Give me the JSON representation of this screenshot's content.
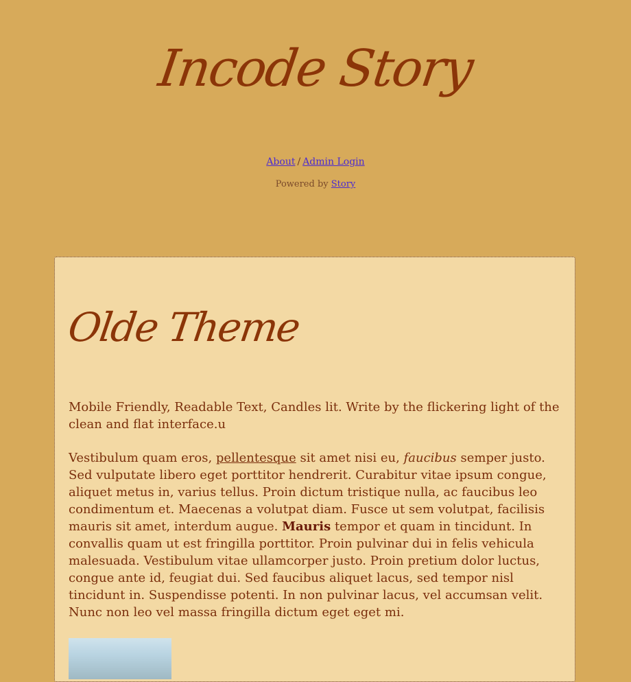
{
  "site": {
    "title": "Incode Story"
  },
  "nav": {
    "about_label": "About",
    "separator": "/",
    "admin_label": "Admin Login"
  },
  "footer": {
    "powered_prefix": "Powered by",
    "powered_link": "Story"
  },
  "post": {
    "title": "Olde Theme",
    "intro": "Mobile Friendly, Readable Text, Candles lit. Write by the flickering light of the clean and flat interface.u",
    "body": {
      "seg1": "Vestibulum quam eros, ",
      "link_text": "pellentesque",
      "seg2": " sit amet nisi eu, ",
      "italic_text": "faucibus",
      "seg3": " semper justo. Sed vulputate libero eget porttitor hendrerit. Curabitur vitae ipsum congue, aliquet metus in, varius tellus. Proin dictum tristique nulla, ac faucibus leo condimentum et. Maecenas a volutpat diam. Fusce ut sem volutpat, facilisis mauris sit amet, interdum augue. ",
      "bold_text": "Mauris",
      "seg4": " tempor et quam in tincidunt. In convallis quam ut est fringilla porttitor. Proin pulvinar dui in felis vehicula malesuada. Vestibulum vitae ullamcorper justo. Proin pretium dolor luctus, congue ante id, feugiat dui. Sed faucibus aliquet lacus, sed tempor nisl tincidunt in. Suspendisse potenti. In non pulvinar lacus, vel accumsan velit. Nunc non leo vel massa fringilla dictum eget eget mi."
    }
  },
  "colors": {
    "page_background": "#d7aa5a",
    "card_background": "#f3d9a4",
    "title_color": "#8b3508",
    "text_color": "#7a2e0c",
    "link_color": "#4b2bd0"
  }
}
